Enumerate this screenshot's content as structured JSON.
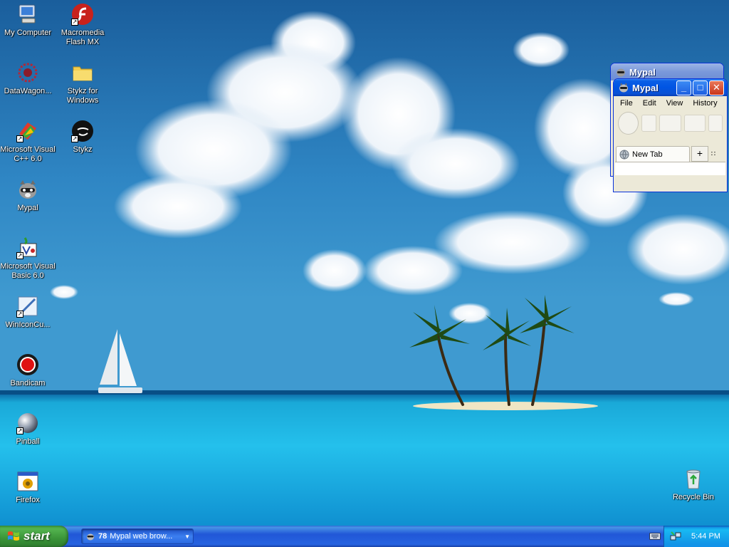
{
  "desktop": {
    "icons": [
      {
        "label": "My Computer",
        "icon": "my-computer-icon",
        "shortcut": false
      },
      {
        "label": "Macromedia\nFlash MX",
        "icon": "flash-mx-icon",
        "shortcut": true
      },
      {
        "label": "DataWagon...",
        "icon": "datawagon-icon",
        "shortcut": false
      },
      {
        "label": "Stykz for\nWindows",
        "icon": "folder-icon",
        "shortcut": false
      },
      {
        "label": "Microsoft Visual\nC++ 6.0",
        "icon": "visual-cpp-icon",
        "shortcut": true
      },
      {
        "label": "Stykz",
        "icon": "stykz-icon",
        "shortcut": true
      },
      {
        "label": "Mypal",
        "icon": "mypal-raccoon-icon",
        "shortcut": false
      },
      {
        "label": "Microsoft Visual\nBasic 6.0",
        "icon": "visual-basic-icon",
        "shortcut": true
      },
      {
        "label": "WinIconCu...",
        "icon": "winiconcut-icon",
        "shortcut": true
      },
      {
        "label": "Bandicam",
        "icon": "bandicam-icon",
        "shortcut": false
      },
      {
        "label": "Pinball",
        "icon": "pinball-icon",
        "shortcut": true
      },
      {
        "label": "Firefox",
        "icon": "firefox-window-icon",
        "shortcut": false
      },
      {
        "label": "Recycle Bin",
        "icon": "recycle-bin-icon",
        "shortcut": false
      }
    ]
  },
  "windows": {
    "back": {
      "title": "Mypal"
    },
    "front": {
      "title": "Mypal",
      "menu": [
        "File",
        "Edit",
        "View",
        "History"
      ],
      "tab_label": "New Tab",
      "new_tab_symbol": "+",
      "tab_list_symbol": "∷"
    }
  },
  "taskbar": {
    "start_label": "start",
    "task_group": {
      "count": "78",
      "label": "Mypal web brow..."
    },
    "clock": "5:44 PM"
  },
  "colors": {
    "taskbar_blue": "#245edb",
    "start_green": "#3c9a3c",
    "titlebar_blue": "#0054e3",
    "close_red": "#c8341a"
  }
}
